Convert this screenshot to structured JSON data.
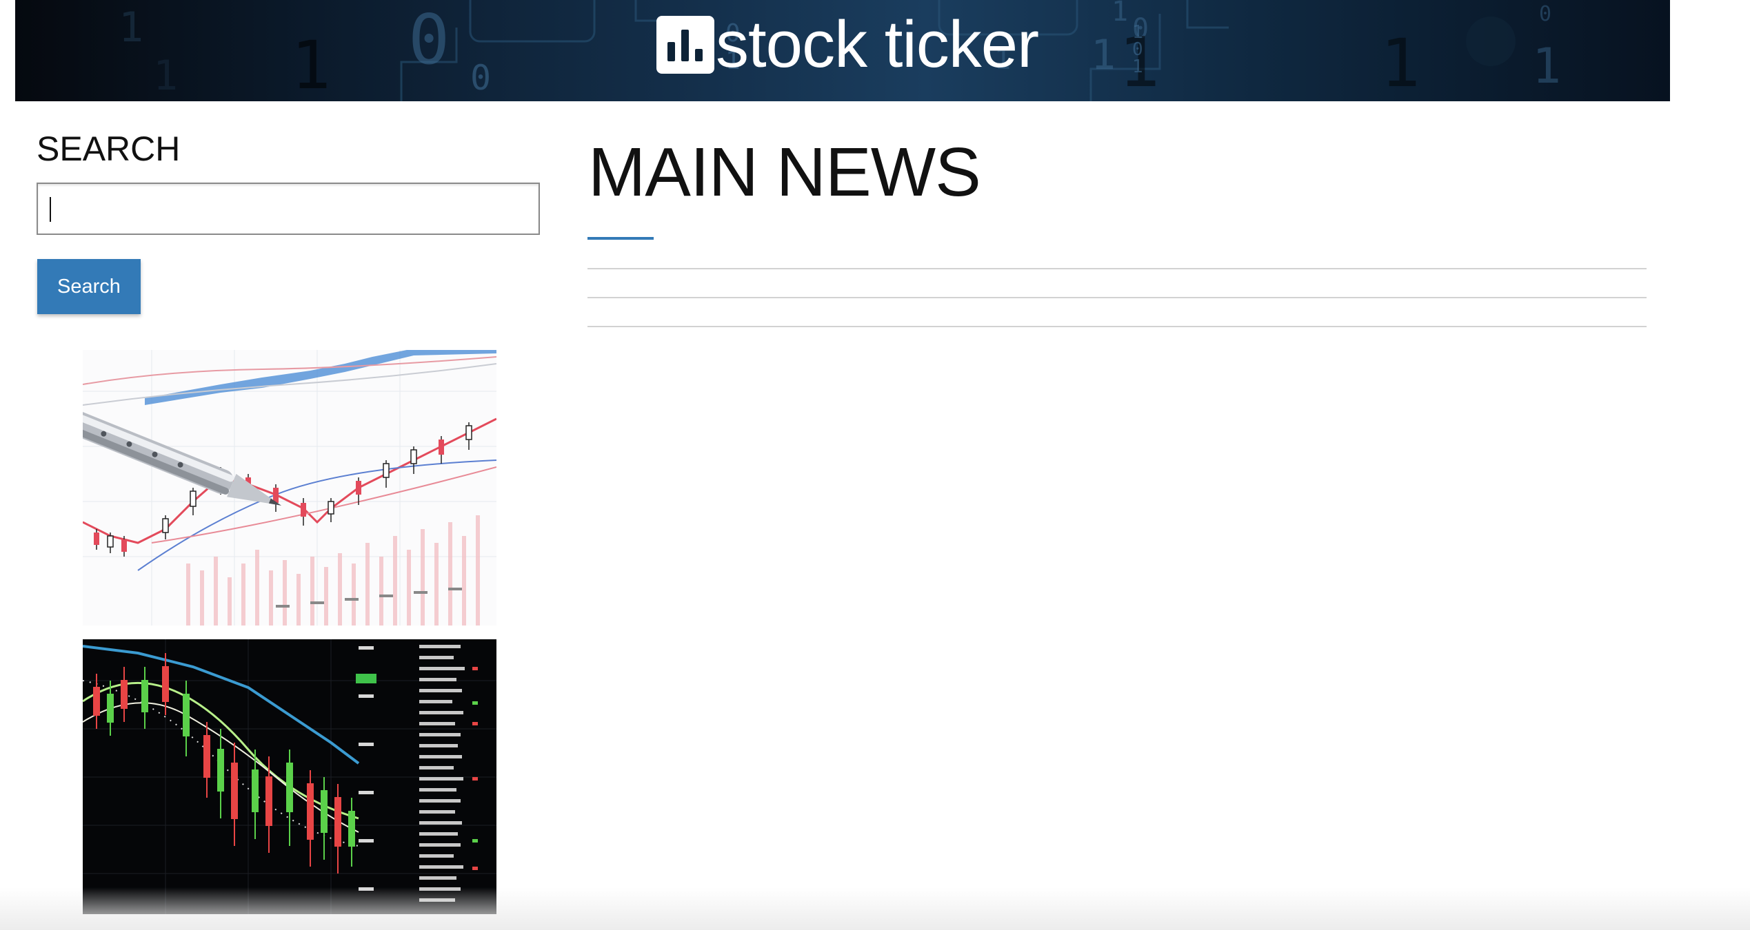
{
  "header": {
    "brand_title": "stock ticker",
    "logo_icon": "bar-chart-icon"
  },
  "sidebar": {
    "search_heading": "SEARCH",
    "search_input_value": "",
    "search_input_placeholder": "",
    "search_button_label": "Search",
    "images": [
      {
        "name": "financial-chart-with-pen-image"
      },
      {
        "name": "candlestick-chart-dark-image"
      }
    ]
  },
  "main": {
    "title": "MAIN NEWS",
    "news_items": []
  },
  "colors": {
    "accent": "#337ab7",
    "banner_dark": "#0b1a2b",
    "divider": "#d2d2d2"
  }
}
